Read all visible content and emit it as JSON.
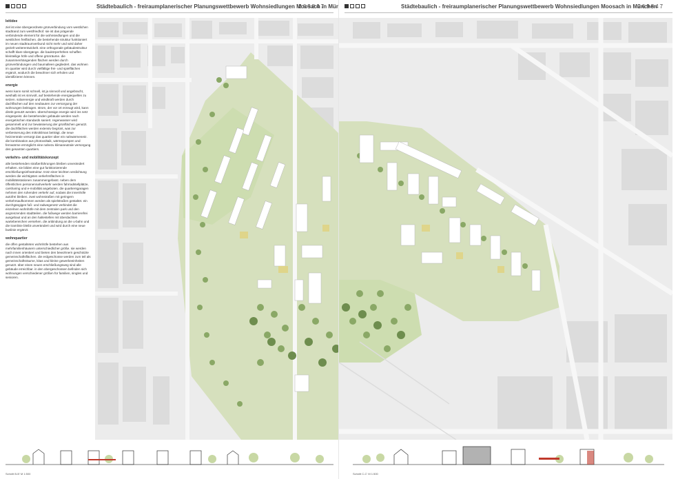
{
  "header": {
    "title": "Städtebaulich - freiraumplanerischer Planungswettbewerb Wohnsiedlungen Moosach in München",
    "number": "269847"
  },
  "text": {
    "leitidee_title": "leitidee",
    "leitidee_body": "ziel ist eine übergeordnete grünverbindung vom westlichen stadtrand zum westfriedhof. sie ist das prägende verbindende element für die wohnsiedlungen und die westlichen freiflächen. die bestehende struktur funktioniert im neuen stadtraumverbund nicht mehr und wird daher gezielt weiterentwickelt. eine orthogonale gebäudestruktur schafft klare übergänge. die baukörperhöhen schaffen kleinteilige höfe und offene grünräume. die zusammenhängenden flächen werden durch grünverbindungen und baumalleen gegliedert. das wohnen im quartier wird durch vielfältige frei- und spielflächen ergänzt, wodurch die bewohner sich erholen und identifizieren können.",
    "energie_title": "energie",
    "energie_body": "wenn kann somit schnell, ist ja sinnvoll und angebracht, weshalb ist es sinnvoll, auf bestehende energiequellen zu setzen. solarenergie und windkraft werden durch dachflächen auf den neubauten zur versorgung der wohnungen beitragen. strom, der vor ort erzeugt wird, kann direkt genutzt werden. überschüssige energie wird ins netz eingespeist. die bestehenden gebäude werden nach energetischen standards saniert. regenwasser wird gesammelt und zur bewässerung der grünflächen genutzt. die dachflächen werden extensiv begrünt, was zur verbesserung des mikroklimas beiträgt. die neue heizzentrale versorgt das quartier über ein nahwärmenetz. die kombination aus photovoltaik, wärmepumpen und fernwärme ermöglicht eine nahezu klimaneutrale versorgung des gesamten quartiers.",
    "verkehr_title": "verkehrs- und mobilitätskonzept",
    "verkehr_body": "alle bestehenden straßenführungen bleiben unverändert erhalten. sie bilden eine gut funktionierende erschließungsinfrastruktur. trotz einer leichten verdichtung werden die wichtigsten verkehrsflächen in mobilitätsstationen zusammengefasst. neben dem öffentlichen personennahverkehr werden fahrradstellplätze, carsharing und e-mobilität angeboten. die quartiersgaragen nehmen den ruhenden verkehr auf, sodass die innenhöfe autofrei bleiben. zwei wohnstraßen mit geringem verkehrsaufkommen werden als spielstraßen gestaltet. ein durchgängiges fuß- und radwegenetz verbindet die einzelnen wohnhöfe mit dem zentralen park und den angrenzenden stadtteilen. die fußwege werden barrierefrei ausgebaut und an den haltestellen mit überdachten wartebereichen versehen. die anbindung an die u-bahn und die tramlinie bleibt unverändert und wird durch eine neue buslinie ergänzt.",
    "wohn_title": "wohnquartier",
    "wohn_body": "die offen gestalteten wohnhöfe bestehen aus mehrfamilienhäusern unterschiedlicher größe. sie werden nach innen orientiert und bieten den bewohnern geschützte gemeinschaftsflächen. die erdgeschosse werden zum teil als gemeinschaftsräume, kitas und kleine gewerbeeinheiten genutzt. über einen neuen erschließungsweg sind alle gebäude erreichbar. in den obergeschossen befinden sich wohnungen verschiedener größen für familien, singles und senioren."
  },
  "sections": {
    "left_label": "Schnitt B-B' M 1:500",
    "right_label": "Schnitt C-C' M 1:500"
  },
  "colors": {
    "background": "#ececec",
    "building": "#ffffff",
    "green": "#c8d8a4",
    "tree": "#8aa866",
    "tree_dark": "#6e8d4e",
    "accent_yellow": "#dfd58a",
    "street": "#f4f4f4"
  }
}
